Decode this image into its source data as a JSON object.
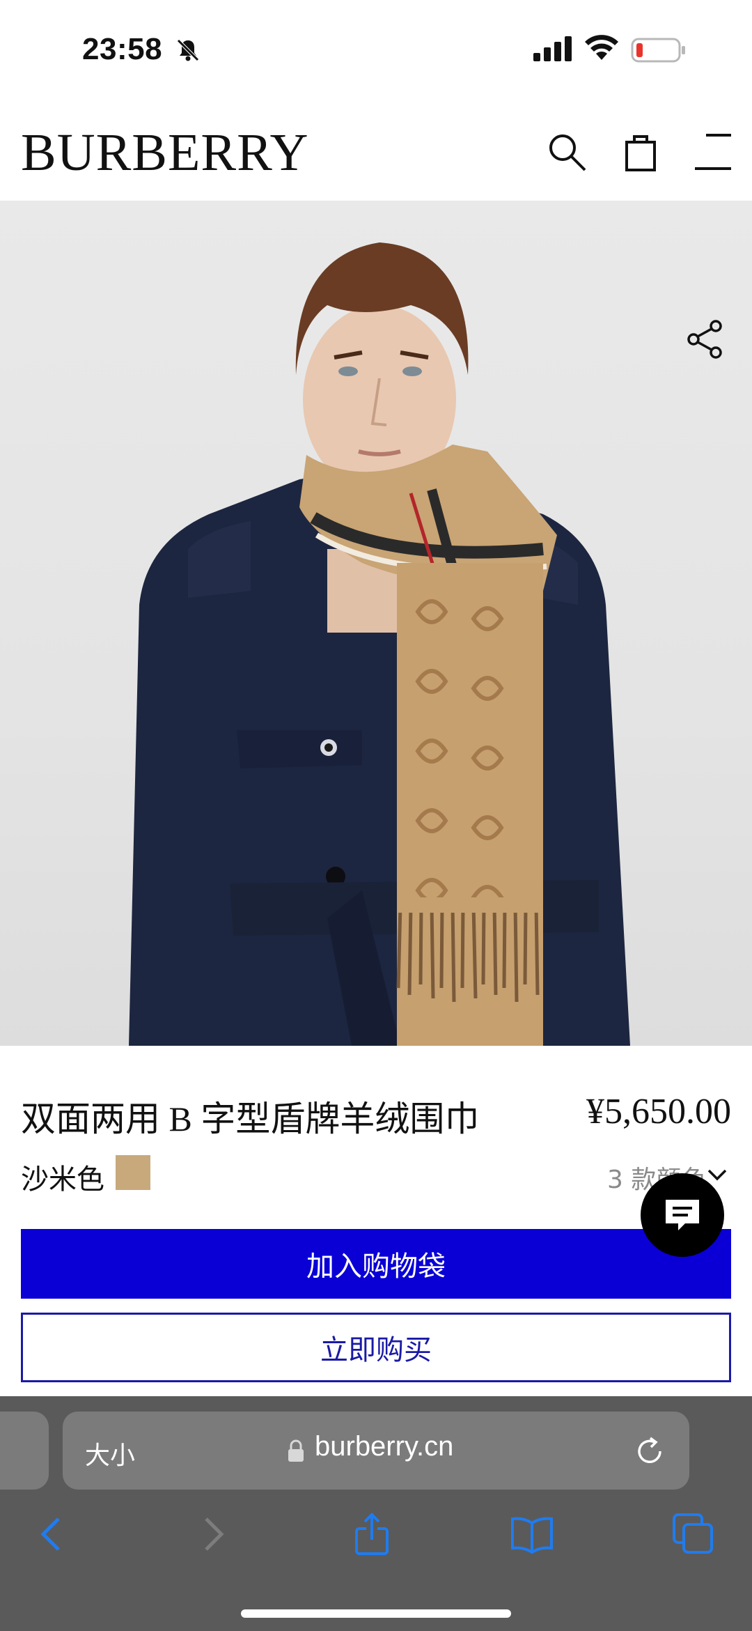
{
  "status_bar": {
    "time": "23:58"
  },
  "header": {
    "brand": "BURBERRY"
  },
  "product": {
    "title": "双面两用 B 字型盾牌羊绒围巾",
    "price": "¥5,650.00",
    "color_name": "沙米色",
    "swatch_color": "#c8a97c",
    "variants_label": "3 款颜色"
  },
  "actions": {
    "add_to_bag": "加入购物袋",
    "buy_now": "立即购买"
  },
  "browser": {
    "text_size_label": "大小",
    "url": "burberry.cn"
  },
  "colors": {
    "primary_button": "#0a00d6",
    "browser_accent": "#1f7cf0"
  },
  "icons": [
    "notifications-off-icon",
    "signal-icon",
    "wifi-icon",
    "battery-icon",
    "search-icon",
    "bag-icon",
    "menu-icon",
    "share-icon",
    "chevron-down-icon",
    "chat-icon",
    "lock-icon",
    "reload-icon",
    "back-icon",
    "forward-icon",
    "share-sheet-icon",
    "bookmarks-icon",
    "tabs-icon"
  ]
}
